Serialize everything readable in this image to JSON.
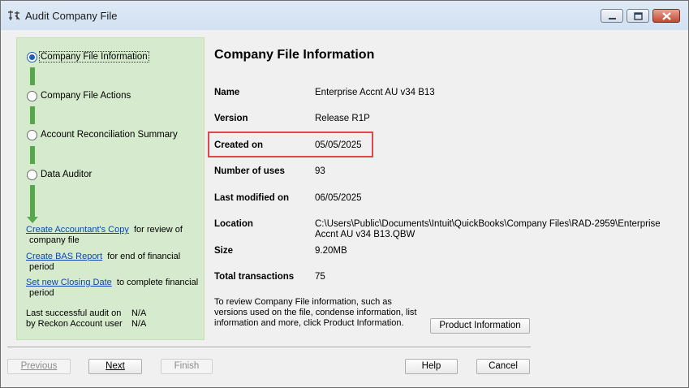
{
  "window": {
    "title": "Audit Company File"
  },
  "steps": [
    {
      "label": "Company File Information",
      "selected": true
    },
    {
      "label": "Company File Actions",
      "selected": false
    },
    {
      "label": "Account Reconciliation Summary",
      "selected": false
    },
    {
      "label": "Data Auditor",
      "selected": false
    }
  ],
  "links": [
    {
      "link": "Create Accountant's Copy",
      "rest1": "for review of",
      "rest2": "company file"
    },
    {
      "link": "Create BAS Report",
      "rest1": "for end of financial",
      "rest2": "period"
    },
    {
      "link": "Set new Closing Date",
      "rest1": "to complete financial",
      "rest2": "period"
    }
  ],
  "audit": {
    "row1_label": "Last successful audit on",
    "row1_value": "N/A",
    "row2_label": "by Reckon Account user",
    "row2_value": "N/A"
  },
  "content": {
    "title": "Company File Information",
    "fields": [
      {
        "label": "Name",
        "value": "Enterprise Accnt AU v34 B13"
      },
      {
        "label": "Version",
        "value": "Release R1P"
      },
      {
        "label": "Created on",
        "value": "05/05/2025"
      },
      {
        "label": "Number of uses",
        "value": "93"
      },
      {
        "label": "Last modified on",
        "value": "06/05/2025"
      },
      {
        "label": "Location",
        "value": "C:\\Users\\Public\\Documents\\Intuit\\QuickBooks\\Company Files\\RAD-2959\\Enterprise Accnt AU v34 B13.QBW"
      },
      {
        "label": "Size",
        "value": "9.20MB"
      },
      {
        "label": "Total transactions",
        "value": "75"
      }
    ],
    "review_text": "To review Company File information, such as versions used on the file, condense information, list information and more, click Product Information.",
    "product_info_button": "Product Information"
  },
  "buttons": {
    "previous": "Previous",
    "next": "Next",
    "finish": "Finish",
    "help": "Help",
    "cancel": "Cancel"
  },
  "colors": {
    "panel_green": "#d6ebcd",
    "step_line": "#57a84d",
    "link": "#0b45b0",
    "highlight": "#e0474c"
  }
}
